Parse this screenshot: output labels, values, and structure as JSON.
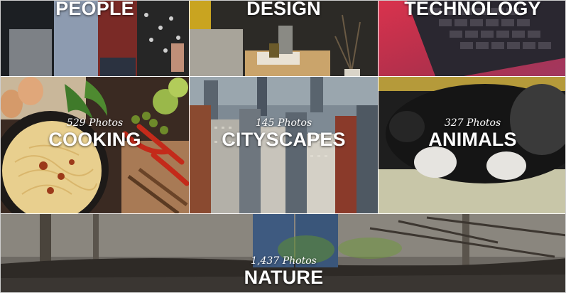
{
  "tiles": [
    {
      "id": "people",
      "title": "PEOPLE",
      "count": ""
    },
    {
      "id": "design",
      "title": "DESIGN",
      "count": ""
    },
    {
      "id": "technology",
      "title": "TECHNOLOGY",
      "count": ""
    },
    {
      "id": "cooking",
      "title": "COOKING",
      "count": "529 Photos"
    },
    {
      "id": "cityscapes",
      "title": "CITYSCAPES",
      "count": "145 Photos"
    },
    {
      "id": "animals",
      "title": "ANIMALS",
      "count": "327 Photos"
    },
    {
      "id": "nature",
      "title": "NATURE",
      "count": "1,437 Photos"
    }
  ]
}
